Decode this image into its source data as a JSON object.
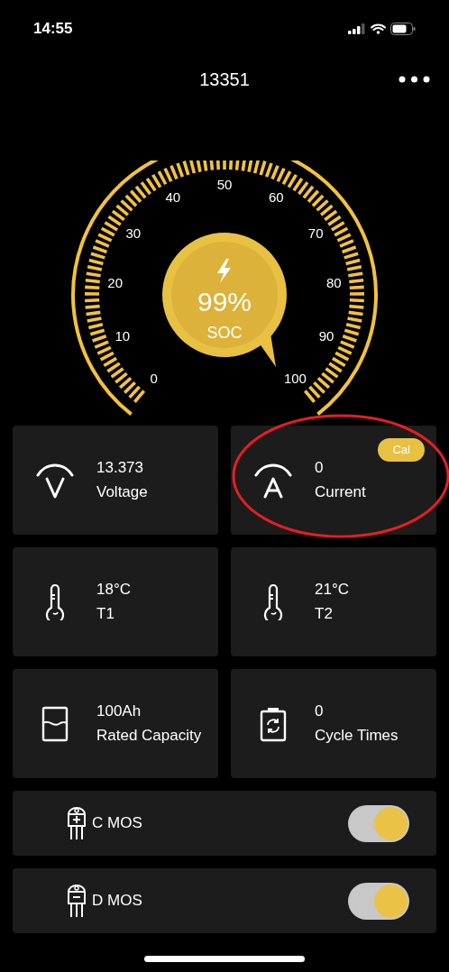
{
  "status_bar": {
    "time": "14:55"
  },
  "header": {
    "title": "13351"
  },
  "gauge": {
    "value": "99%",
    "label": "SOC",
    "scale_labels": [
      "0",
      "10",
      "20",
      "30",
      "40",
      "50",
      "60",
      "70",
      "80",
      "90",
      "100"
    ]
  },
  "metrics": [
    {
      "kind": "voltage",
      "value": "13.373",
      "label": "Voltage"
    },
    {
      "kind": "current",
      "value": "0",
      "label": "Current"
    },
    {
      "kind": "thermometer",
      "value": "18°C",
      "label": "T1"
    },
    {
      "kind": "thermometer",
      "value": "21°C",
      "label": "T2"
    },
    {
      "kind": "capacity",
      "value": "100Ah",
      "label": "Rated Capacity"
    },
    {
      "kind": "cycle",
      "value": "0",
      "label": "Cycle Times"
    }
  ],
  "calibrate_button": {
    "label": "Cal"
  },
  "switches": [
    {
      "kind": "charge",
      "label": "C MOS",
      "on": true
    },
    {
      "kind": "discharge",
      "label": "D MOS",
      "on": true
    }
  ]
}
